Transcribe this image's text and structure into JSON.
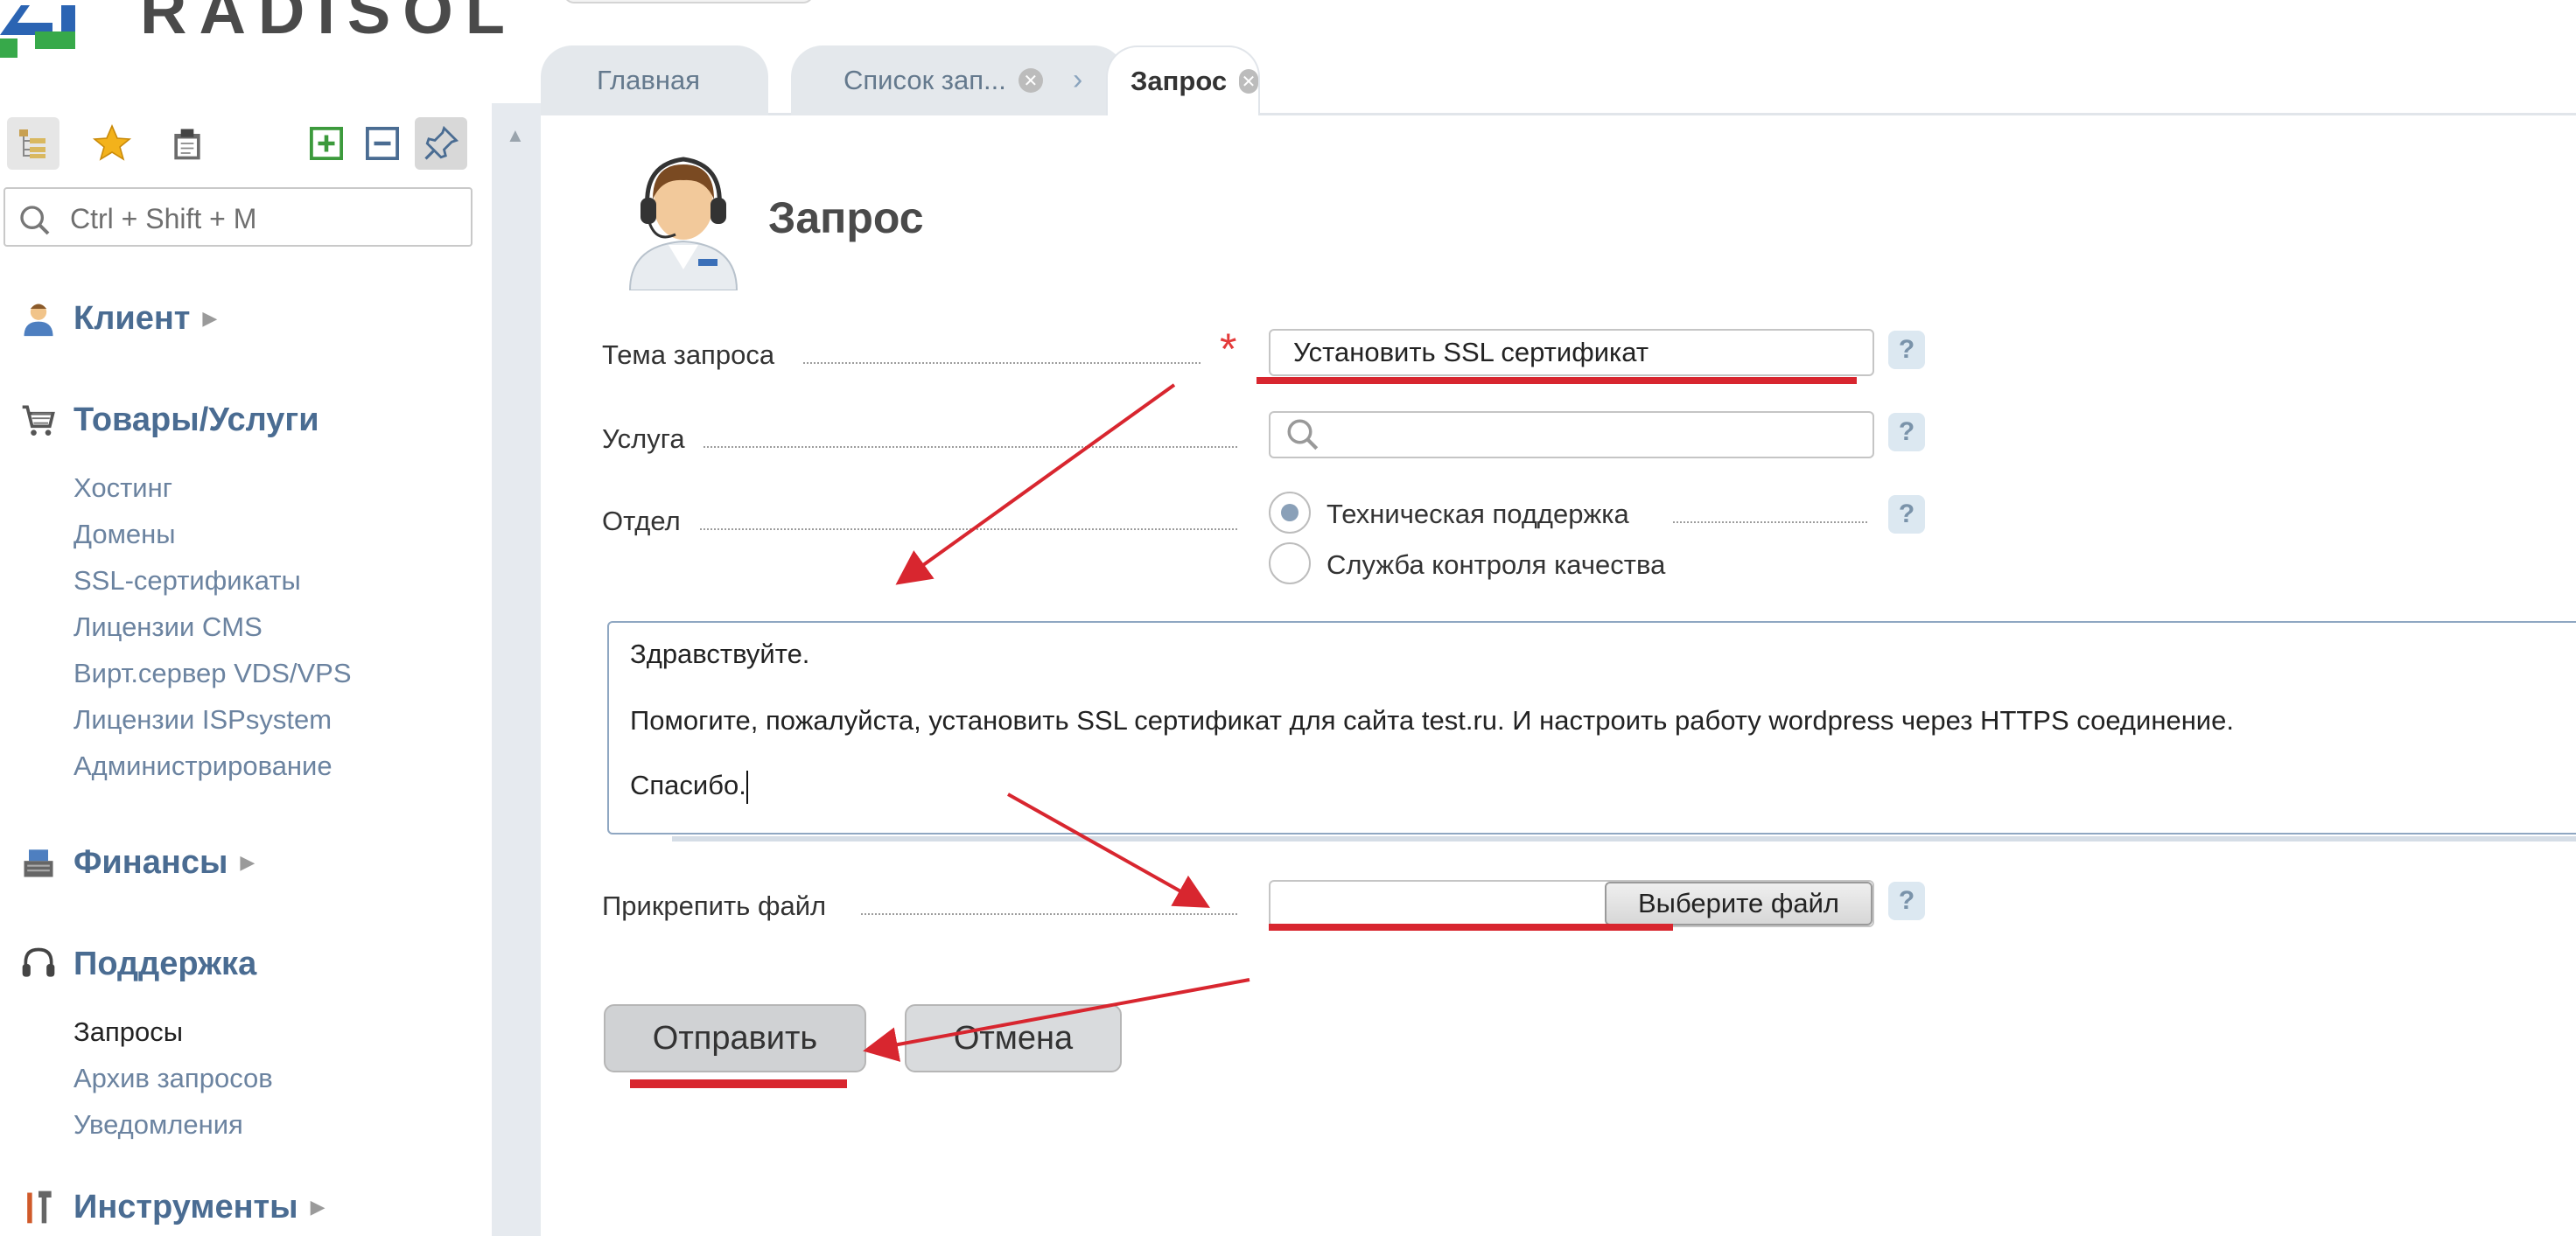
{
  "brand": {
    "name": "RADISOL"
  },
  "sidebar": {
    "search_placeholder": "Ctrl + Shift + M",
    "sections": {
      "client": {
        "label": "Клиент"
      },
      "goods": {
        "label": "Товары/Услуги",
        "items": [
          "Хостинг",
          "Домены",
          "SSL-сертификаты",
          "Лицензии CMS",
          "Вирт.сервер VDS/VPS",
          "Лицензии ISPsystem",
          "Администрирование"
        ]
      },
      "finance": {
        "label": "Финансы"
      },
      "support": {
        "label": "Поддержка",
        "items": [
          "Запросы",
          "Архив запросов",
          "Уведомления"
        ]
      },
      "tools": {
        "label": "Инструменты"
      }
    }
  },
  "tabs": [
    {
      "label": "Главная"
    },
    {
      "label": "Список зап..."
    },
    {
      "label": "Запрос"
    }
  ],
  "page": {
    "title": "Запрос",
    "fields": {
      "subject": {
        "label": "Тема запроса",
        "value": "Установить SSL сертификат",
        "required": true
      },
      "service": {
        "label": "Услуга",
        "value": ""
      },
      "department": {
        "label": "Отдел",
        "options": [
          "Техническая поддержка",
          "Служба контроля качества"
        ],
        "selected": "Техническая поддержка"
      },
      "message": {
        "lines": [
          "Здравствуйте.",
          "Помогите, пожалуйста, установить SSL сертификат для сайта test.ru. И настроить работу wordpress через HTTPS соединение.",
          "Спасибо."
        ]
      },
      "attach": {
        "label": "Прикрепить файл",
        "button": "Выберите файл"
      }
    },
    "help_label": "?",
    "required_mark": "*",
    "buttons": {
      "send": "Отправить",
      "cancel": "Отмена"
    }
  },
  "colors": {
    "accent": "#4a6c92",
    "annotation": "#d8262f",
    "required": "#e43a3a"
  }
}
